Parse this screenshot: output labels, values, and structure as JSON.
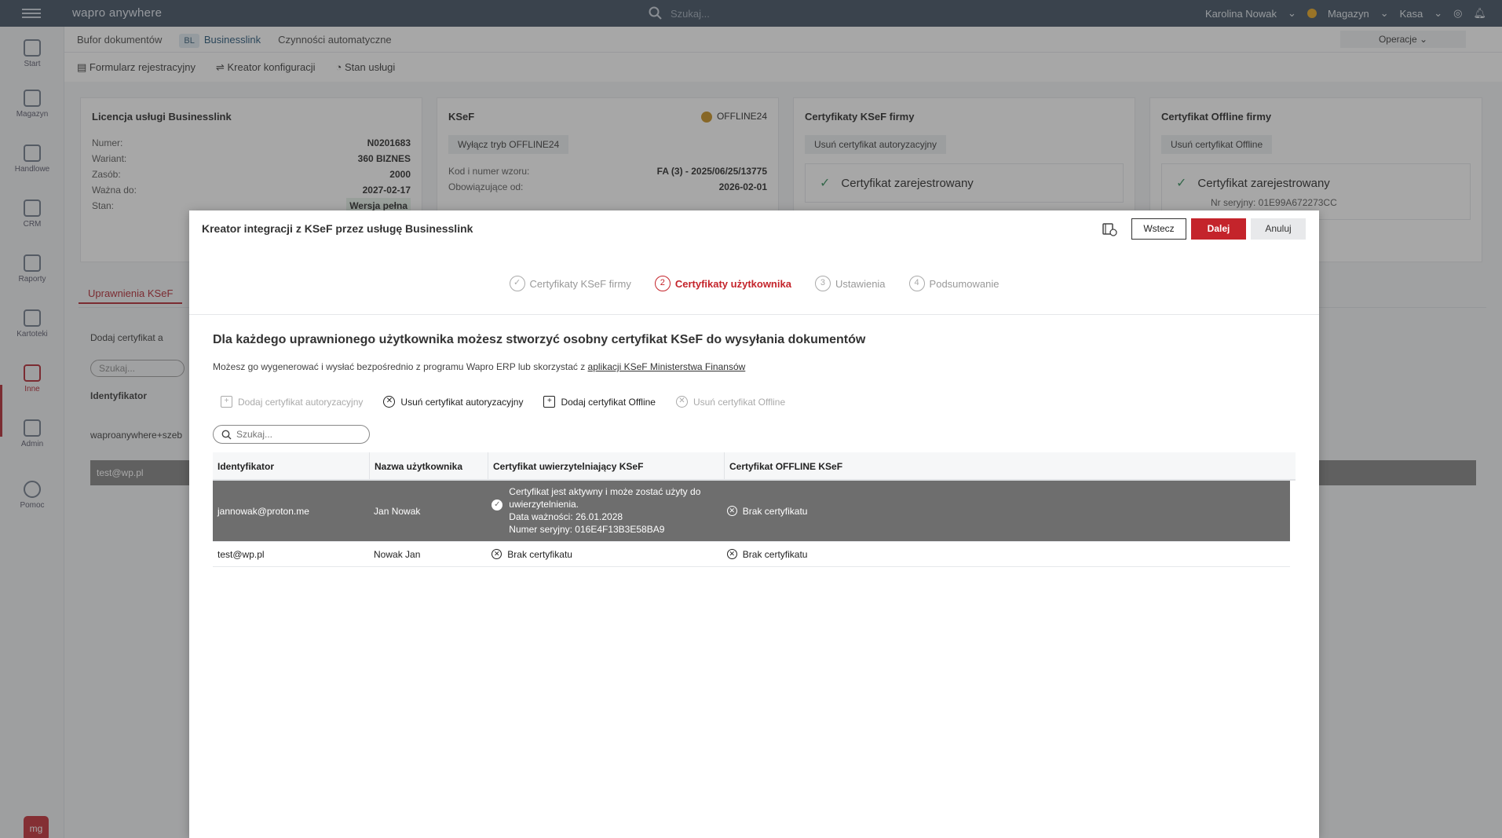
{
  "app": {
    "brand": "wapro anywhere",
    "search_placeholder": "Szukaj...",
    "user": "Karolina Nowak",
    "warehouse": "Magazyn",
    "cash": "Kasa"
  },
  "sidebar": {
    "items": [
      {
        "label": "Start"
      },
      {
        "label": "Magazyn"
      },
      {
        "label": "Handlowe"
      },
      {
        "label": "CRM"
      },
      {
        "label": "Raporty"
      },
      {
        "label": "Kartoteki"
      },
      {
        "label": "Inne"
      },
      {
        "label": "Admin"
      },
      {
        "label": "Pomoc"
      }
    ],
    "logo": "mg"
  },
  "subnav": {
    "items": [
      "Bufor dokumentów",
      "Businesslink",
      "Czynności automatyczne"
    ],
    "badge": "BL",
    "operations": "Operacje"
  },
  "toolbar": {
    "items": [
      "Formularz rejestracyjny",
      "Kreator konfiguracji",
      "Stan usługi"
    ]
  },
  "cards": {
    "license": {
      "title": "Licencja usługi Businesslink",
      "rows": [
        {
          "k": "Numer:",
          "v": "N0201683"
        },
        {
          "k": "Wariant:",
          "v": "360 BIZNES"
        },
        {
          "k": "Zasób:",
          "v": "2000"
        },
        {
          "k": "Ważna do:",
          "v": "2027-02-17"
        },
        {
          "k": "Stan:",
          "v": "Wersja pełna"
        }
      ]
    },
    "ksef": {
      "title": "KSeF",
      "status": "OFFLINE24",
      "button": "Wyłącz tryb OFFLINE24",
      "rows": [
        {
          "k": "Kod i numer wzoru:",
          "v": "FA (3) - 2025/06/25/13775"
        },
        {
          "k": "Obowiązujące od:",
          "v": "2026-02-01"
        }
      ]
    },
    "ksef_certs": {
      "title": "Certyfikaty KSeF firmy",
      "button": "Usuń certyfikat autoryzacyjny",
      "status": "Certyfikat zarejestrowany"
    },
    "offline_certs": {
      "title": "Certyfikat Offline firmy",
      "button": "Usuń certyfikat Offline",
      "status": "Certyfikat zarejestrowany",
      "serial": "Nr seryjny: 01E99A672273CC"
    }
  },
  "background": {
    "tab": "Uprawnienia KSeF",
    "add_label": "Dodaj certyfikat a",
    "search": "Szukaj...",
    "col": "Identyfikator",
    "row1": "waproanywhere+szeb",
    "row2": "test@wp.pl"
  },
  "modal": {
    "title": "Kreator integracji z KSeF przez usługę Businesslink",
    "buttons": {
      "back": "Wstecz",
      "next": "Dalej",
      "cancel": "Anuluj"
    },
    "steps": [
      {
        "num": "✓",
        "label": "Certyfikaty KSeF firmy"
      },
      {
        "num": "2",
        "label": "Certyfikaty użytkownika"
      },
      {
        "num": "3",
        "label": "Ustawienia"
      },
      {
        "num": "4",
        "label": "Podsumowanie"
      }
    ],
    "heading": "Dla każdego uprawnionego użytkownika możesz stworzyć osobny certyfikat KSeF do wysyłania dokumentów",
    "desc_prefix": "Możesz go wygenerować i wysłać bezpośrednio z programu Wapro ERP lub skorzystać z ",
    "desc_link": "aplikacji KSeF Ministerstwa Finansów",
    "toolbar": {
      "add_auth": "Dodaj certyfikat autoryzacyjny",
      "remove_auth": "Usuń certyfikat autoryzacyjny",
      "add_offline": "Dodaj certyfikat Offline",
      "remove_offline": "Usuń certyfikat Offline"
    },
    "search_placeholder": "Szukaj...",
    "table": {
      "columns": [
        "Identyfikator",
        "Nazwa użytkownika",
        "Certyfikat uwierzytelniający KSeF",
        "Certyfikat OFFLINE KSeF"
      ],
      "rows": [
        {
          "id": "jannowak@proton.me",
          "name": "Jan Nowak",
          "auth_line1": "Certyfikat jest aktywny i może zostać użyty do uwierzytelnienia.",
          "auth_line2": "Data ważności: 26.01.2028",
          "auth_line3": "Numer seryjny: 016E4F13B3E58BA9",
          "offline": "Brak certyfikatu"
        },
        {
          "id": "test@wp.pl",
          "name": "Nowak Jan",
          "auth": "Brak certyfikatu",
          "offline": "Brak certyfikatu"
        }
      ]
    }
  }
}
